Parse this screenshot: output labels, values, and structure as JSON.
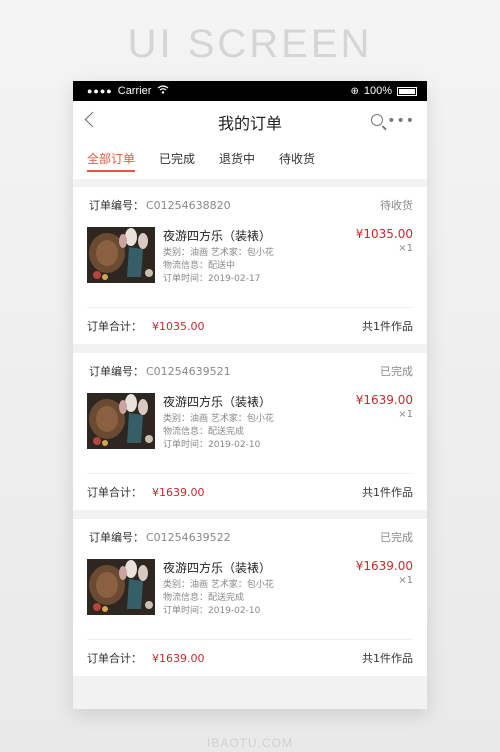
{
  "banner": "UI SCREEN",
  "status_bar": {
    "carrier": "Carrier",
    "battery": "100%"
  },
  "nav": {
    "title": "我的订单"
  },
  "tabs": [
    {
      "label": "全部订单",
      "active": true
    },
    {
      "label": "已完成",
      "active": false
    },
    {
      "label": "退货中",
      "active": false
    },
    {
      "label": "待收货",
      "active": false
    }
  ],
  "orders": [
    {
      "no_label": "订单编号：",
      "no": "C01254638820",
      "status": "待收货",
      "title": "夜游四方乐（装裱）",
      "category": "类别：油画   艺术家：包小花",
      "logistics": "物流信息：配送中",
      "time": "订单时间：2019-02-17",
      "price": "¥1035.00",
      "qty": "×1",
      "total_label": "订单合计：",
      "total": "¥1035.00",
      "count": "共1件作品"
    },
    {
      "no_label": "订单编号：",
      "no": "C01254639521",
      "status": "已完成",
      "title": "夜游四方乐（装裱）",
      "category": "类别：油画   艺术家：包小花",
      "logistics": "物流信息：配送完成",
      "time": "订单时间：2019-02-10",
      "price": "¥1639.00",
      "qty": "×1",
      "total_label": "订单合计：",
      "total": "¥1639.00",
      "count": "共1件作品"
    },
    {
      "no_label": "订单编号：",
      "no": "C01254639522",
      "status": "已完成",
      "title": "夜游四方乐（装裱）",
      "category": "类别：油画   艺术家：包小花",
      "logistics": "物流信息：配送完成",
      "time": "订单时间：2019-02-10",
      "price": "¥1639.00",
      "qty": "×1",
      "total_label": "订单合计：",
      "total": "¥1639.00",
      "count": "共1件作品"
    }
  ],
  "icons": [
    "back-icon",
    "search-icon",
    "more-icon",
    "wifi-icon",
    "battery-icon"
  ],
  "colors": {
    "accent": "#e55a3c",
    "price": "#c62b2b"
  },
  "watermark": "IBAOTU.COM"
}
